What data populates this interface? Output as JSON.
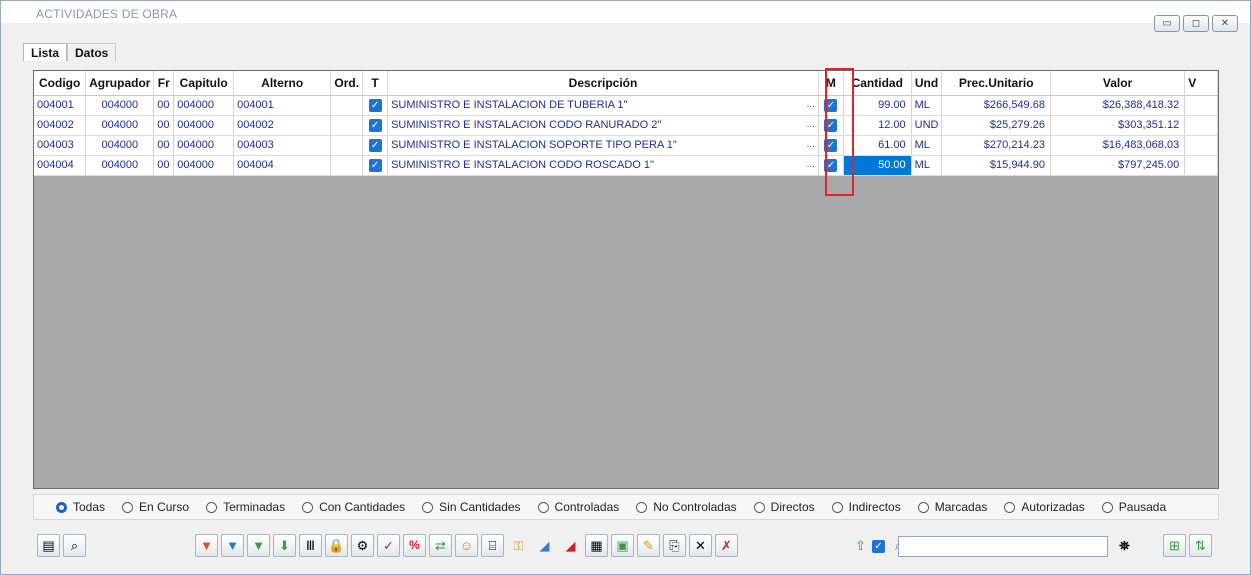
{
  "window": {
    "title": "ACTIVIDADES DE OBRA"
  },
  "tabs": [
    "Lista",
    "Datos"
  ],
  "grid": {
    "columns": [
      "Codigo",
      "Agrupador",
      "Fr",
      "Capitulo",
      "Alterno",
      "Ord.",
      "T",
      "Descripción",
      "M",
      "Cantidad",
      "Und",
      "Prec.Unitario",
      "Valor",
      "V"
    ],
    "rows": [
      {
        "codigo": "004001",
        "agrupador": "004000",
        "fr": "00",
        "capitulo": "004000",
        "alterno": "004001",
        "ord": "",
        "t": true,
        "descripcion": "SUMINISTRO E INSTALACION DE TUBERIA 1\"",
        "m": true,
        "cantidad": "99.00",
        "und": "ML",
        "precio": "$266,549.68",
        "valor": "$26,388,418.32"
      },
      {
        "codigo": "004002",
        "agrupador": "004000",
        "fr": "00",
        "capitulo": "004000",
        "alterno": "004002",
        "ord": "",
        "t": true,
        "descripcion": "SUMINISTRO E INSTALACION CODO RANURADO 2\"",
        "m": true,
        "cantidad": "12.00",
        "und": "UND",
        "precio": "$25,279.26",
        "valor": "$303,351.12"
      },
      {
        "codigo": "004003",
        "agrupador": "004000",
        "fr": "00",
        "capitulo": "004000",
        "alterno": "004003",
        "ord": "",
        "t": true,
        "descripcion": "SUMINISTRO E INSTALACION SOPORTE TIPO PERA 1\"",
        "m": true,
        "cantidad": "61.00",
        "und": "ML",
        "precio": "$270,214.23",
        "valor": "$16,483,068.03"
      },
      {
        "codigo": "004004",
        "agrupador": "004000",
        "fr": "00",
        "capitulo": "004000",
        "alterno": "004004",
        "ord": "",
        "t": true,
        "descripcion": "SUMINISTRO E INSTALACION CODO ROSCADO 1\"",
        "m": true,
        "cantidad": "50.00",
        "und": "ML",
        "precio": "$15,944.90",
        "valor": "$797,245.00"
      }
    ],
    "selected_row": 3
  },
  "filters": {
    "options": [
      "Todas",
      "En Curso",
      "Terminadas",
      "Con Cantidades",
      "Sin Cantidades",
      "Controladas",
      "No Controladas",
      "Directos",
      "Indirectos",
      "Marcadas",
      "Autorizadas",
      "Pausada"
    ],
    "selected": "Todas"
  },
  "toolbar": {
    "search_value": ""
  },
  "colors": {
    "accent": "#0078d7",
    "highlight_border": "#e0232b",
    "grid_text": "#1c2f93"
  }
}
